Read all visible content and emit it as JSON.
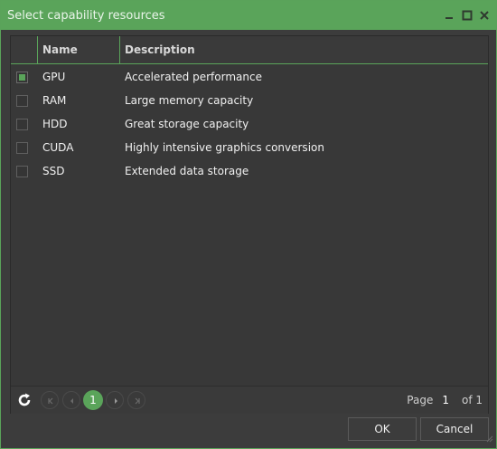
{
  "window": {
    "title": "Select capability resources"
  },
  "grid": {
    "columns": {
      "name": "Name",
      "description": "Description"
    },
    "rows": [
      {
        "name": "GPU",
        "description": "Accelerated performance",
        "checked": true
      },
      {
        "name": "RAM",
        "description": "Large memory capacity",
        "checked": false
      },
      {
        "name": "HDD",
        "description": "Great storage capacity",
        "checked": false
      },
      {
        "name": "CUDA",
        "description": "Highly intensive graphics conversion",
        "checked": false
      },
      {
        "name": "SSD",
        "description": "Extended data storage",
        "checked": false
      }
    ]
  },
  "pager": {
    "current_page_button": "1",
    "page_label": "Page",
    "page_value": "1",
    "of_label": "of 1"
  },
  "buttons": {
    "ok": "OK",
    "cancel": "Cancel"
  },
  "icons": {
    "minimize": "minimize-icon",
    "maximize": "maximize-icon",
    "close": "close-icon",
    "refresh": "refresh-icon",
    "first": "first-page-icon",
    "prev": "previous-page-icon",
    "next": "next-page-icon",
    "last": "last-page-icon"
  },
  "colors": {
    "accent": "#5aa45a",
    "background": "#3c3c3c"
  }
}
